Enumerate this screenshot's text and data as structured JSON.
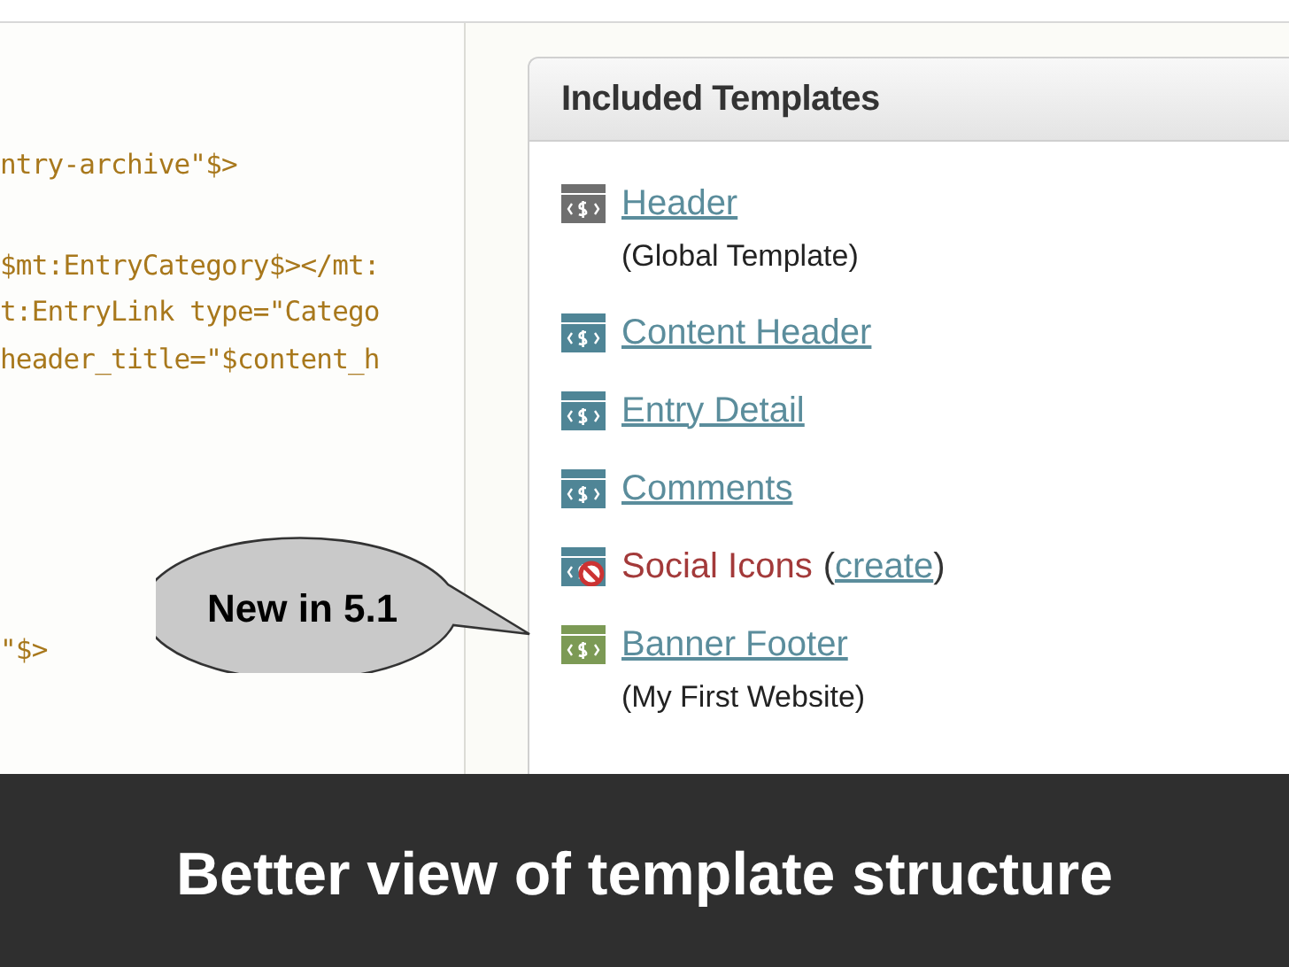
{
  "code_blocks": [
    [
      "ntry-archive\"$>"
    ],
    [
      "$mt:EntryCategory$></mt:",
      "t:EntryLink type=\"Catego",
      "header_title=\"$content_h"
    ],
    [
      "\"$>"
    ]
  ],
  "callout": {
    "text": "New in 5.1"
  },
  "panel": {
    "title": "Included Templates",
    "items": [
      {
        "kind": "global",
        "name": "Header",
        "note": "(Global Template)"
      },
      {
        "kind": "local",
        "name": "Content Header"
      },
      {
        "kind": "local",
        "name": "Entry Detail"
      },
      {
        "kind": "local",
        "name": "Comments"
      },
      {
        "kind": "missing",
        "name": "Social Icons",
        "paren_open": "(",
        "action": "create",
        "paren_close": ")"
      },
      {
        "kind": "website",
        "name": "Banner Footer",
        "note": "(My First Website)"
      }
    ]
  },
  "caption": "Better view of template structure"
}
